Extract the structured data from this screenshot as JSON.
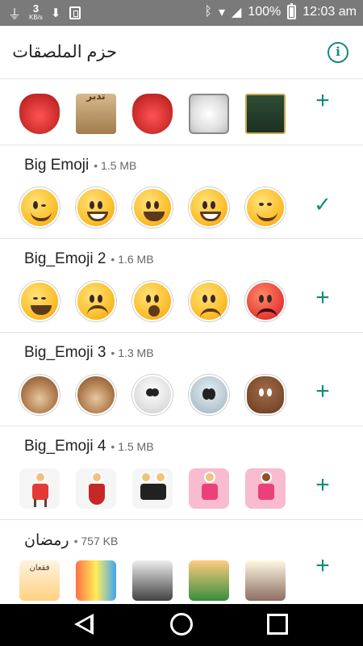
{
  "status_bar": {
    "speed_value": "3",
    "speed_unit": "KB/s",
    "battery_percent": "100%",
    "time": "12:03 am",
    "icons": [
      "usb-icon",
      "download-icon",
      "storage-icon",
      "bluetooth-icon",
      "wifi-icon",
      "signal-icon",
      "battery-icon"
    ]
  },
  "app_bar": {
    "title": "حزم الملصقات",
    "info_icon": "info-icon"
  },
  "packs": [
    {
      "name": "",
      "size": "",
      "action": "add",
      "action_glyph": "+"
    },
    {
      "name": "Big Emoji",
      "size": "1.5 MB",
      "action": "added",
      "action_glyph": "✓"
    },
    {
      "name": "Big_Emoji 2",
      "size": "1.6 MB",
      "action": "add",
      "action_glyph": "+"
    },
    {
      "name": "Big_Emoji 3",
      "size": "1.3 MB",
      "action": "add",
      "action_glyph": "+"
    },
    {
      "name": "Big_Emoji 4",
      "size": "1.5 MB",
      "action": "add",
      "action_glyph": "+"
    },
    {
      "name": "رمضان",
      "size": "757 KB",
      "action": "add",
      "action_glyph": "+"
    }
  ],
  "sticker_captions": {
    "pack1": [
      "",
      "تدبر",
      "",
      "",
      ""
    ],
    "pack6": [
      "فقعان",
      "",
      "",
      "",
      ""
    ]
  },
  "nav_bar": {
    "icons": [
      "back-icon",
      "home-icon",
      "recents-icon"
    ]
  },
  "colors": {
    "accent": "#128c7e",
    "status_bar": "#7a7a7a",
    "divider": "#e3e3e3"
  }
}
